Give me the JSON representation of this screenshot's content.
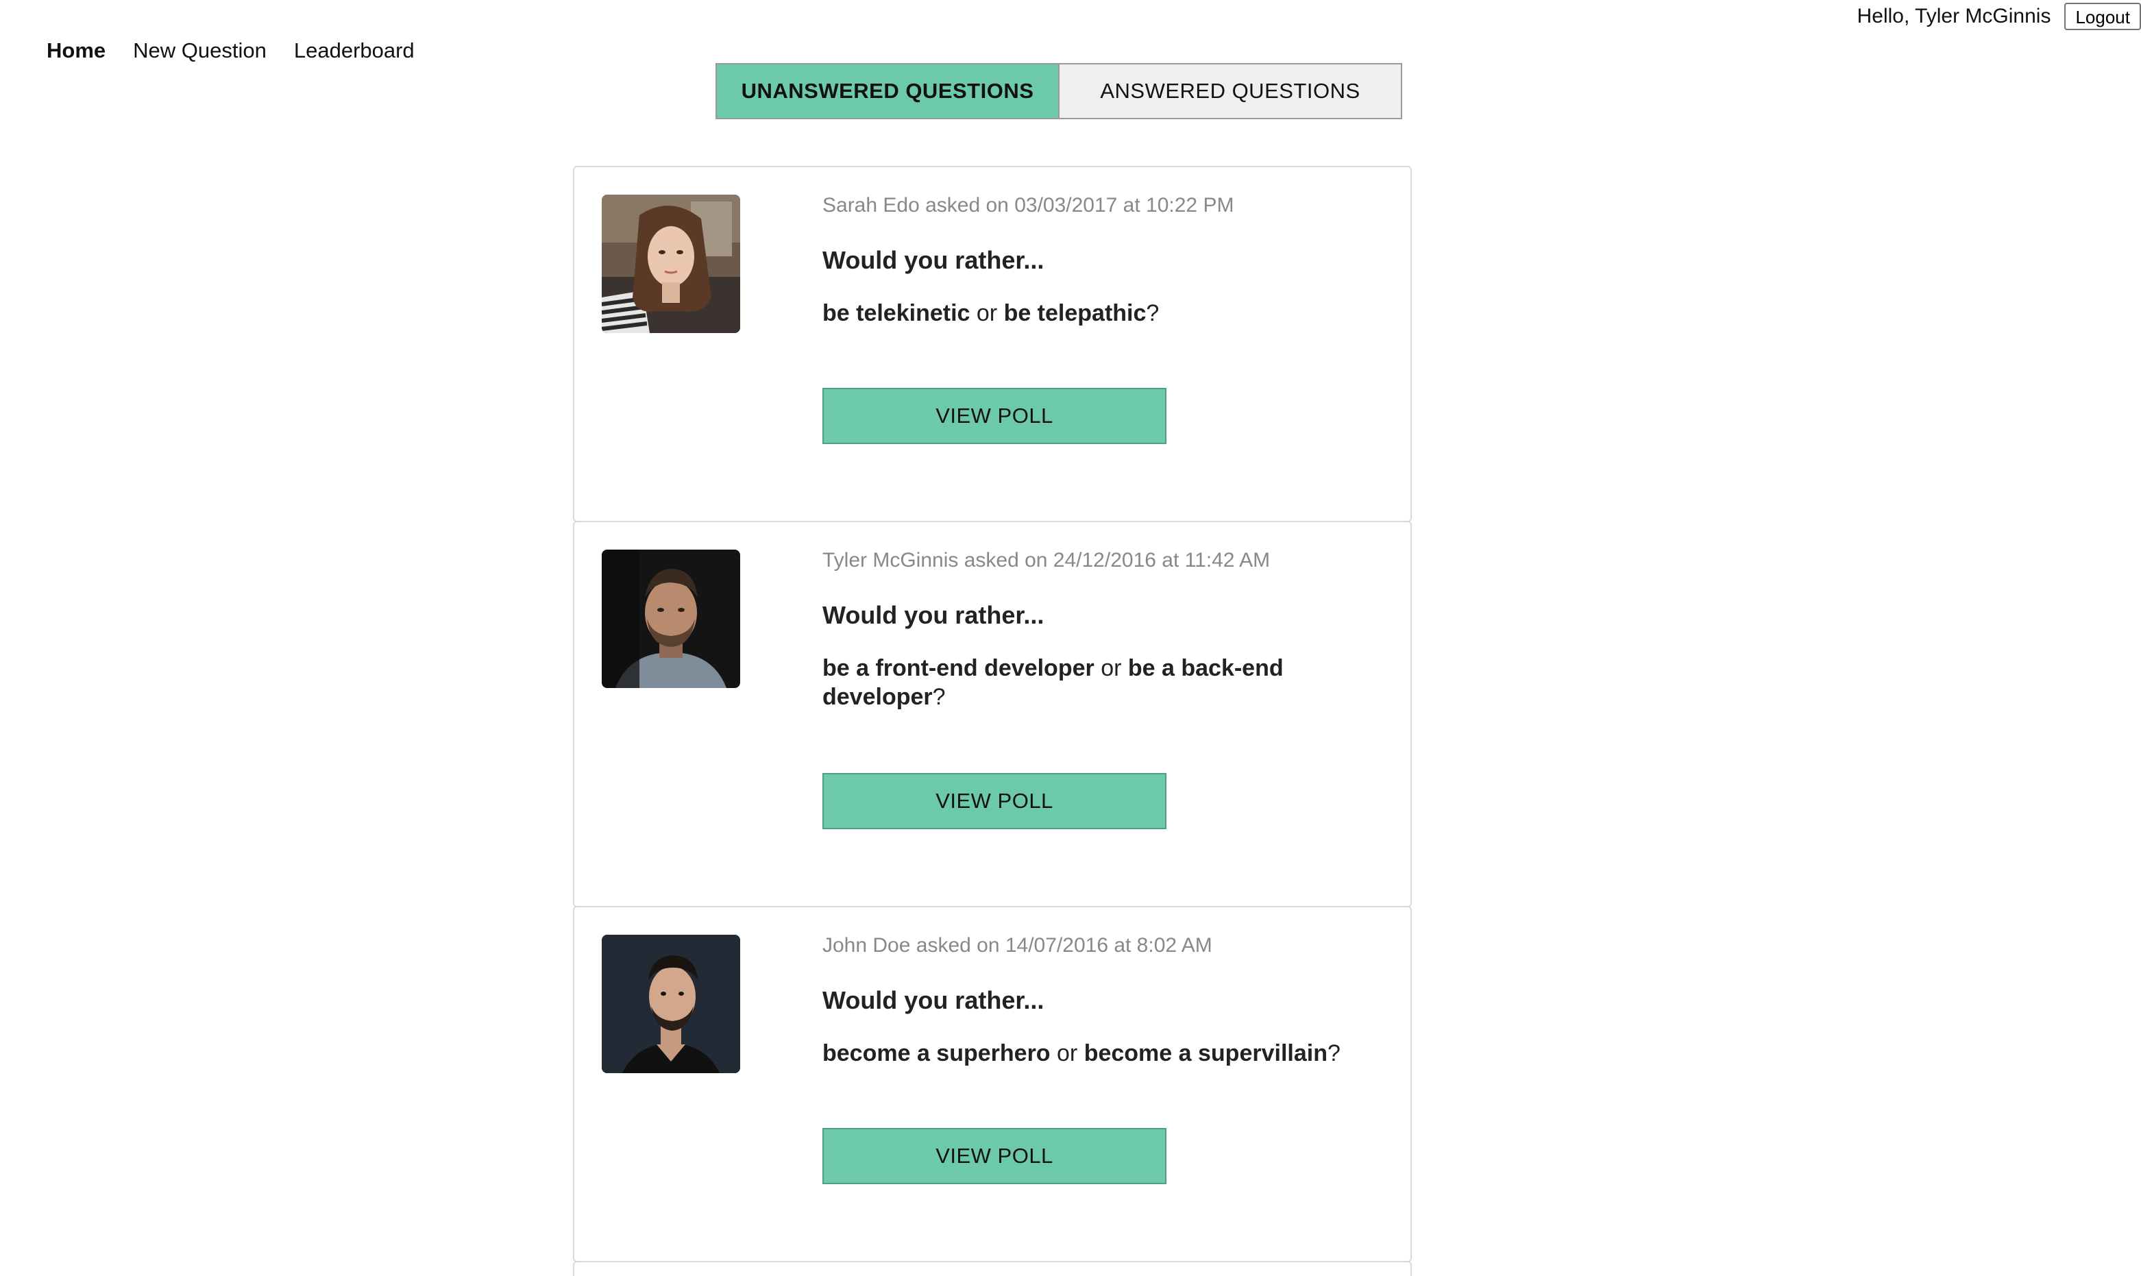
{
  "header": {
    "greeting": "Hello, Tyler McGinnis",
    "logout_label": "Logout"
  },
  "nav": {
    "items": [
      {
        "label": "Home",
        "active": true
      },
      {
        "label": "New Question",
        "active": false
      },
      {
        "label": "Leaderboard",
        "active": false
      }
    ]
  },
  "tabs": {
    "unanswered_label": "UNANSWERED QUESTIONS",
    "answered_label": "ANSWERED QUESTIONS",
    "active": "unanswered"
  },
  "questions": [
    {
      "author": "Sarah Edo",
      "meta": "Sarah Edo asked on 03/03/2017 at 10:22 PM",
      "prompt": "Would you rather...",
      "option_one": "be telekinetic",
      "separator": "or",
      "option_two": "be telepathic",
      "suffix": "?",
      "button_label": "VIEW POLL"
    },
    {
      "author": "Tyler McGinnis",
      "meta": "Tyler McGinnis asked on 24/12/2016 at 11:42 AM",
      "prompt": "Would you rather...",
      "option_one": "be a front-end developer",
      "separator": "or",
      "option_two": "be a back-end developer",
      "suffix": "?",
      "button_label": "VIEW POLL"
    },
    {
      "author": "John Doe",
      "meta": "John Doe asked on 14/07/2016 at 8:02 AM",
      "prompt": "Would you rather...",
      "option_one": "become a superhero",
      "separator": "or",
      "option_two": "become a supervillain",
      "suffix": "?",
      "button_label": "VIEW POLL"
    }
  ],
  "colors": {
    "accent": "#6dcaa8",
    "tab_inactive": "#efefef",
    "meta_text": "#888888",
    "card_border": "#d9d9d9"
  }
}
